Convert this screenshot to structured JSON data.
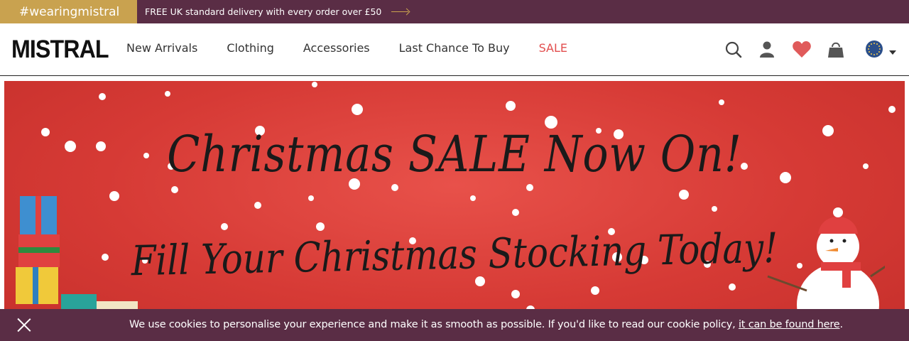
{
  "topbar": {
    "hashtag": "#wearingmistral",
    "promo_text": "FREE UK standard delivery with every order over £50"
  },
  "header": {
    "logo": "MISTRAL",
    "nav": [
      "New Arrivals",
      "Clothing",
      "Accessories",
      "Last Chance To Buy",
      "SALE"
    ],
    "icons": [
      "search-icon",
      "account-icon",
      "wishlist-heart-icon",
      "bag-icon",
      "eu-flag-icon",
      "chevron-down-icon"
    ]
  },
  "banner": {
    "line1": "Christmas SALE Now On!",
    "line2": "Fill Your Christmas Stocking Today!"
  },
  "cookie": {
    "message": "We use cookies to personalise your experience and make it as smooth as possible. If you'd like to read our cookie policy, ",
    "link": "it can be found here",
    "end": "."
  },
  "colors": {
    "brand_plum": "#5a2d45",
    "gold": "#c9a24f",
    "sale_red": "#e24e4e",
    "banner_red": "#d63a35"
  }
}
